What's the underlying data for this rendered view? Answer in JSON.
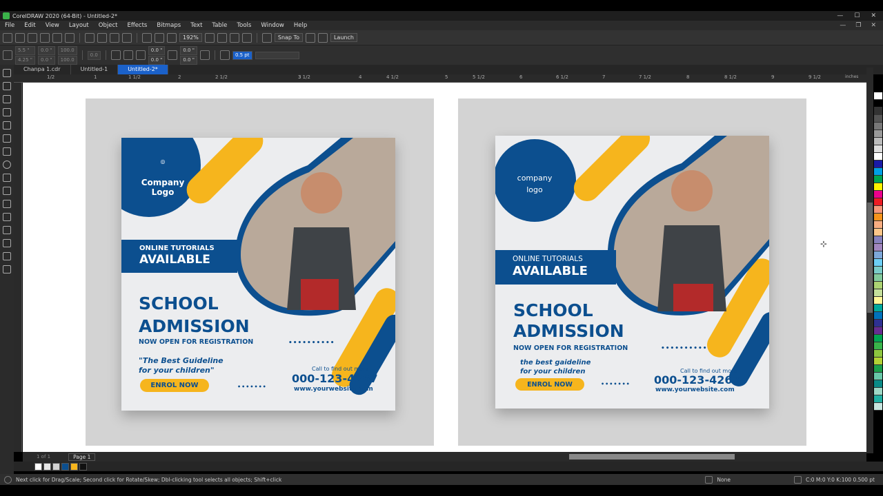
{
  "window": {
    "title": "CorelDRAW 2020 (64-Bit) - Untitled-2*"
  },
  "menu": [
    "File",
    "Edit",
    "View",
    "Layout",
    "Object",
    "Effects",
    "Bitmaps",
    "Text",
    "Table",
    "Tools",
    "Window",
    "Help"
  ],
  "standard_toolbar": {
    "zoom": "192%",
    "snap_to": "Snap To",
    "launch": "Launch"
  },
  "property_bar": {
    "x": "5.5 \"",
    "y": "4.25 \"",
    "w": "0.0 \"",
    "h": "0.0 \"",
    "sx": "100.0",
    "sy": "100.0",
    "angle": "0.0",
    "corner1": "0.0 \"",
    "corner2": "0.0 \"",
    "corner3": "0.0 \"",
    "corner4": "0.0 \"",
    "outline": "0.5 pt"
  },
  "doc_tabs": [
    "Chanpa 1.cdr",
    "Untitled-1",
    "Untitled-2*"
  ],
  "active_tab": "Untitled-2*",
  "ruler": {
    "ticks": [
      "1/2",
      "1",
      "1 1/2",
      "2",
      "2 1/2",
      "3",
      "3 1/2",
      "4",
      "4 1/2",
      "5",
      "5 1/2",
      "6",
      "6 1/2",
      "7",
      "7 1/2",
      "8",
      "8 1/2",
      "9",
      "9 1/2"
    ],
    "unit": "inches"
  },
  "page": {
    "counter": "1 of 1",
    "tab": "Page 1"
  },
  "status": {
    "hint": "Next click for Drag/Scale; Second click for Rotate/Skew; Dbl-clicking tool selects all objects; Shift+click",
    "fill": "None",
    "outline": "C:0 M:0 Y:0 K:100  0.500 pt"
  },
  "colors": {
    "brand_blue": "#0c4f8f",
    "accent_yellow": "#f6b51d",
    "selection_blue": "#1b61c9"
  },
  "flyer_left": {
    "logo_line1": "Company",
    "logo_line2": "Logo",
    "band_line1": "ONLINE TUTORIALS",
    "band_line2": "AVAILABLE",
    "headline1": "SCHOOL",
    "headline2": "ADMISSION",
    "sub": "NOW OPEN FOR REGISTRATION",
    "quote1": "\"The Best Guideline",
    "quote2": "for your children\"",
    "button": "ENROL NOW",
    "call": "Call to find out more",
    "phone": "000-123-4267",
    "website": "www.yourwebsite.com"
  },
  "flyer_right": {
    "logo_line1": "company",
    "logo_line2": "logo",
    "band_line1": "ONLINE TUTORIALS",
    "band_line2": "AVAILABLE",
    "headline1": "SCHOOL",
    "headline2": "ADMISSION",
    "sub": "NOW OPEN FOR REGISTRATION",
    "quote1": "the best gaideline",
    "quote2": "for your children",
    "button": "ENROL NOW",
    "call": "Call to find out more",
    "phone": "000-123-4267",
    "website": "www.yourwebsite.com"
  }
}
